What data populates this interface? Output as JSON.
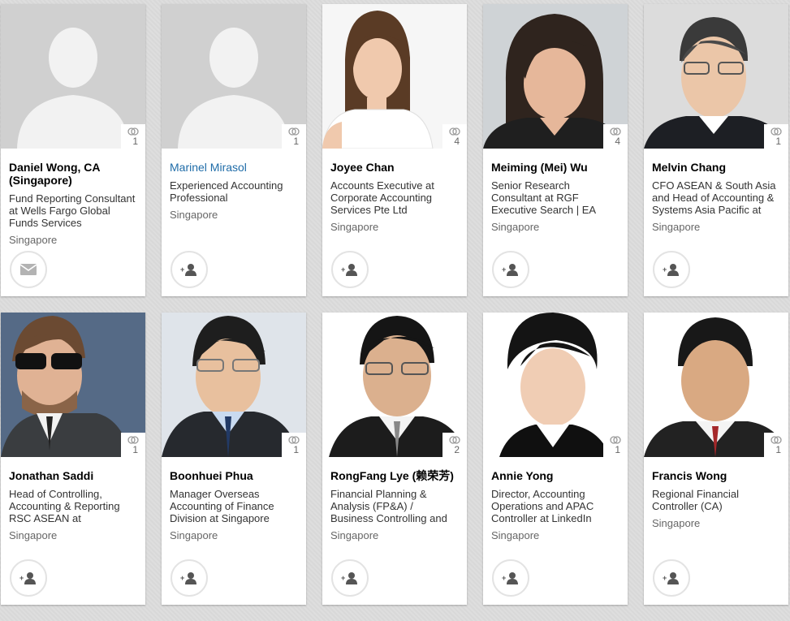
{
  "people": [
    {
      "name": "Daniel Wong, CA (Singapore)",
      "headline": "Fund Reporting Consultant at Wells Fargo Global Funds Services",
      "location": "Singapore",
      "shared_connections": "1",
      "action_icon": "mail-icon",
      "photo": "default-avatar"
    },
    {
      "name": "Marinel Mirasol",
      "headline": "Experienced Accounting Professional",
      "location": "Singapore",
      "shared_connections": "1",
      "action_icon": "add-connection-icon",
      "photo": "default-avatar"
    },
    {
      "name": "Joyee Chan",
      "headline": "Accounts Executive at Corporate Accounting Services Pte Ltd",
      "location": "Singapore",
      "shared_connections": "4",
      "action_icon": "add-connection-icon",
      "photo": "profile-photo"
    },
    {
      "name": "Meiming (Mei) Wu",
      "headline": "Senior Research Consultant at RGF Executive Search | EA",
      "location": "Singapore",
      "shared_connections": "4",
      "action_icon": "add-connection-icon",
      "photo": "profile-photo"
    },
    {
      "name": "Melvin Chang",
      "headline": "CFO ASEAN & South Asia and Head of Accounting & Systems Asia Pacific at",
      "location": "Singapore",
      "shared_connections": "1",
      "action_icon": "add-connection-icon",
      "photo": "profile-photo"
    },
    {
      "name": "Jonathan Saddi",
      "headline": "Head of Controlling, Accounting & Reporting RSC ASEAN at",
      "location": "Singapore",
      "shared_connections": "1",
      "action_icon": "add-connection-icon",
      "photo": "profile-photo"
    },
    {
      "name": "Boonhuei Phua",
      "headline": "Manager Overseas Accounting of Finance Division at Singapore",
      "location": "Singapore",
      "shared_connections": "1",
      "action_icon": "add-connection-icon",
      "photo": "profile-photo"
    },
    {
      "name": "RongFang Lye (赖荣芳)",
      "headline": "Financial Planning & Analysis (FP&A) / Business Controlling and",
      "location": "Singapore",
      "shared_connections": "2",
      "action_icon": "add-connection-icon",
      "photo": "profile-photo"
    },
    {
      "name": "Annie Yong",
      "headline": "Director, Accounting Operations and APAC Controller at LinkedIn",
      "location": "Singapore",
      "shared_connections": "1",
      "action_icon": "add-connection-icon",
      "photo": "profile-photo"
    },
    {
      "name": "Francis Wong",
      "headline": "Regional Financial Controller (CA)",
      "location": "Singapore",
      "shared_connections": "1",
      "action_icon": "add-connection-icon",
      "photo": "profile-photo"
    }
  ],
  "colors": {
    "link": "#1f6ca8",
    "avatar_bg": "#d0d0d0",
    "avatar_fg": "#f2f2f2"
  }
}
